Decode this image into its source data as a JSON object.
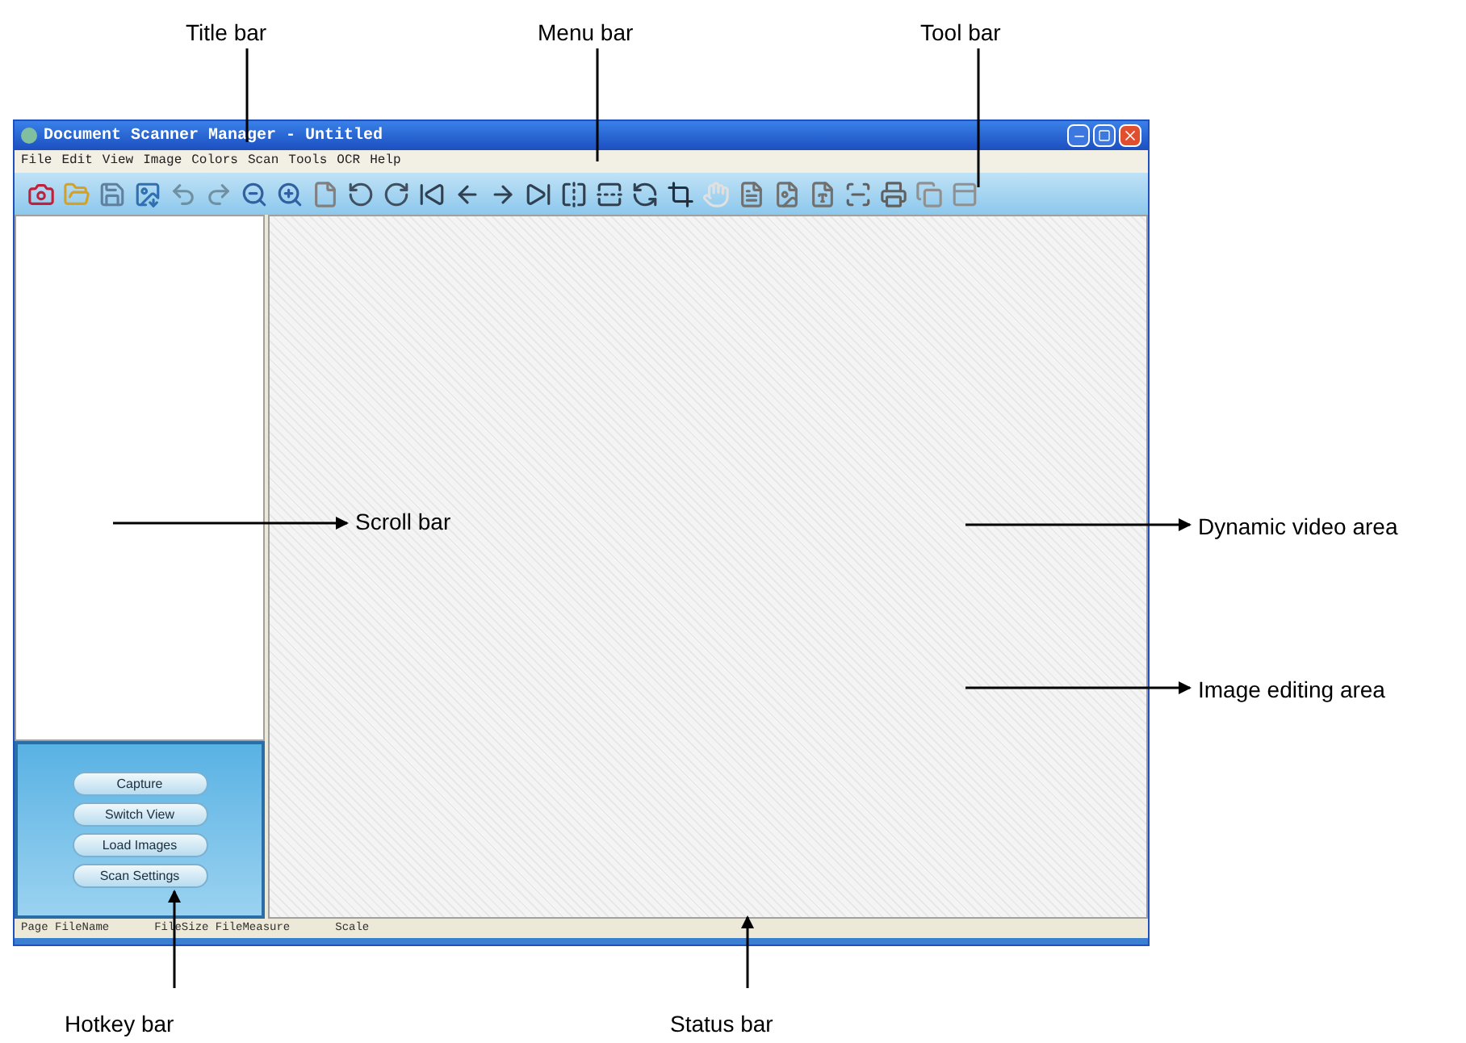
{
  "window": {
    "title": "Document Scanner Manager - Untitled"
  },
  "menu": [
    "File",
    "Edit",
    "View",
    "Image",
    "Colors",
    "Scan",
    "Tools",
    "OCR",
    "Help"
  ],
  "hotkeys": [
    "Capture",
    "Switch View",
    "Load Images",
    "Scan Settings"
  ],
  "status_bar": [
    "Page FileName",
    "FileSize FileMeasure",
    "Scale"
  ],
  "annotations": [
    {
      "label": "Title bar"
    },
    {
      "label": "Menu bar"
    },
    {
      "label": "Tool bar"
    },
    {
      "label": "Scroll bar"
    },
    {
      "label": "Dynamic video area"
    },
    {
      "label": "Image editing area"
    },
    {
      "label": "Hotkey bar"
    },
    {
      "label": "Status bar"
    }
  ]
}
